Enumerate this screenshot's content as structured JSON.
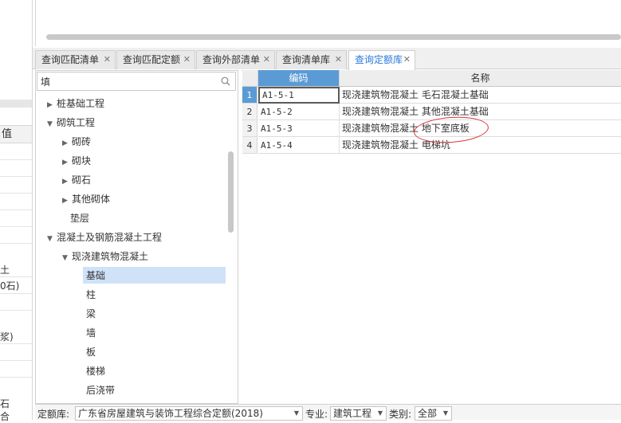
{
  "left_panel": {
    "header": "值",
    "visible_fragments": [
      "土",
      "0石)",
      "浆)",
      "石",
      "合"
    ]
  },
  "tabs": [
    {
      "label": "查询匹配清单",
      "active": false
    },
    {
      "label": "查询匹配定额",
      "active": false
    },
    {
      "label": "查询外部清单",
      "active": false
    },
    {
      "label": "查询清单库",
      "active": false
    },
    {
      "label": "查询定额库",
      "active": true
    }
  ],
  "search": {
    "value": "填",
    "placeholder": ""
  },
  "tree": [
    {
      "label": "桩基础工程",
      "level": 1,
      "arrow": "right"
    },
    {
      "label": "砌筑工程",
      "level": 1,
      "arrow": "down"
    },
    {
      "label": "砌砖",
      "level": 2,
      "arrow": "right"
    },
    {
      "label": "砌块",
      "level": 2,
      "arrow": "right"
    },
    {
      "label": "砌石",
      "level": 2,
      "arrow": "right"
    },
    {
      "label": "其他砌体",
      "level": 2,
      "arrow": "right"
    },
    {
      "label": "垫层",
      "level": 2,
      "arrow": ""
    },
    {
      "label": "混凝土及钢筋混凝土工程",
      "level": 1,
      "arrow": "down"
    },
    {
      "label": "现浇建筑物混凝土",
      "level": 2,
      "arrow": "down"
    },
    {
      "label": "基础",
      "level": 3,
      "arrow": "",
      "selected": true
    },
    {
      "label": "柱",
      "level": 3,
      "arrow": ""
    },
    {
      "label": "梁",
      "level": 3,
      "arrow": ""
    },
    {
      "label": "墙",
      "level": 3,
      "arrow": ""
    },
    {
      "label": "板",
      "level": 3,
      "arrow": ""
    },
    {
      "label": "楼梯",
      "level": 3,
      "arrow": ""
    },
    {
      "label": "后浇带",
      "level": 3,
      "arrow": ""
    }
  ],
  "grid": {
    "columns": [
      "编码",
      "名称"
    ],
    "rows": [
      {
        "num": "1",
        "code": "A1-5-1",
        "name": "现浇建筑物混凝土 毛石混凝土基础"
      },
      {
        "num": "2",
        "code": "A1-5-2",
        "name": "现浇建筑物混凝土 其他混凝土基础"
      },
      {
        "num": "3",
        "code": "A1-5-3",
        "name": "现浇建筑物混凝土 地下室底板"
      },
      {
        "num": "4",
        "code": "A1-5-4",
        "name": "现浇建筑物混凝土 电梯坑"
      }
    ]
  },
  "bottom": {
    "library_label": "定额库:",
    "library_value": "广东省房屋建筑与装饰工程综合定额(2018)",
    "major_label": "专业:",
    "major_value": "建筑工程",
    "category_label": "类别:",
    "category_value": "全部"
  },
  "colors": {
    "accent": "#5b9bd5",
    "active_tab_text": "#2a7ad8",
    "selection": "#cfe2f7",
    "annotation": "#d9363e"
  }
}
